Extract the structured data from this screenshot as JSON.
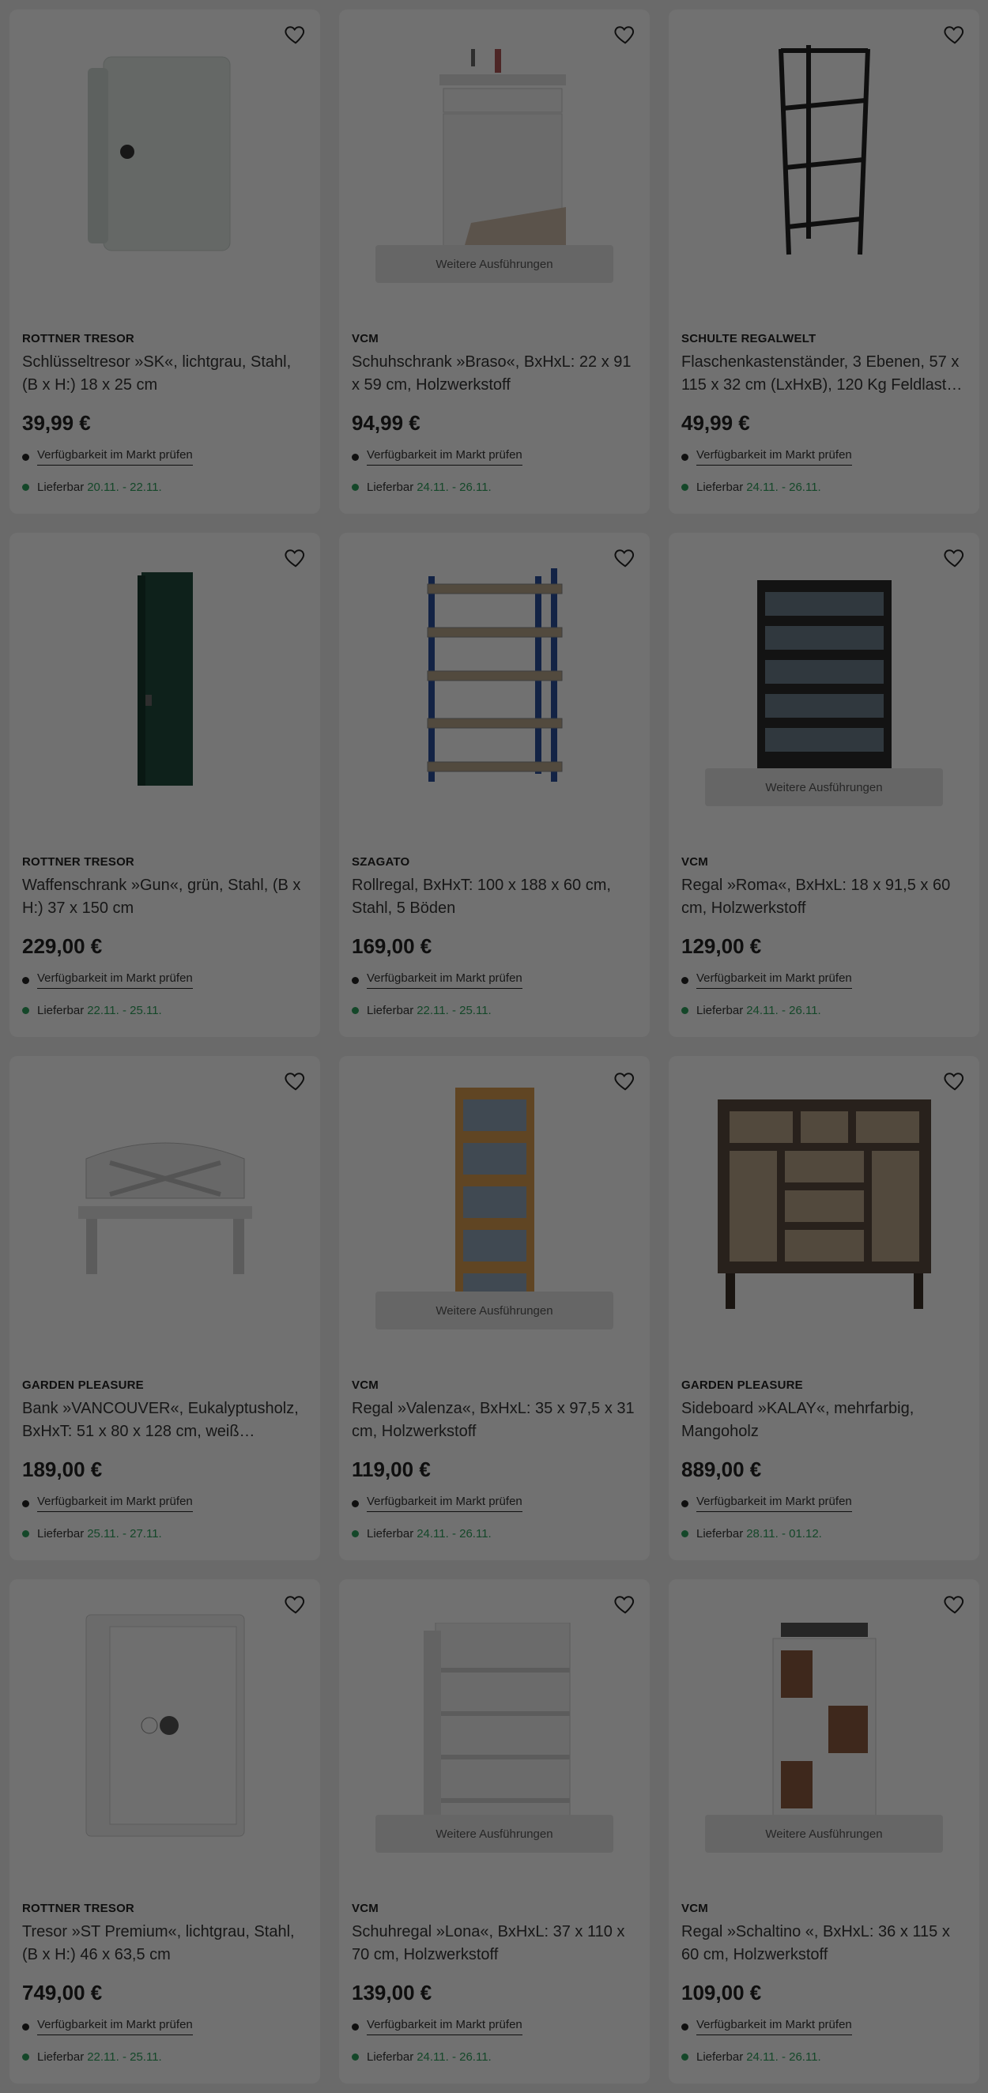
{
  "products": [
    {
      "brand": "ROTTNER TRESOR",
      "title": "Schlüsseltresor »SK«, lichtgrau, Stahl, (B x H:) 18 x 25 cm",
      "price": "39,99 €",
      "availability": "Verfügbarkeit im Markt prüfen",
      "delivery_label": "Lieferbar",
      "delivery_dates": "20.11. - 22.11.",
      "variants": "",
      "image": "key-safe"
    },
    {
      "brand": "VCM",
      "title": "Schuhschrank »Braso«, BxHxL: 22 x 91 x 59 cm, Holzwerkstoff",
      "price": "94,99 €",
      "availability": "Verfügbarkeit im Markt prüfen",
      "delivery_label": "Lieferbar",
      "delivery_dates": "24.11. - 26.11.",
      "variants": "Weitere Ausführungen",
      "image": "shoe-cabinet"
    },
    {
      "brand": "SCHULTE REGALWELT",
      "title": "Flaschenkastenständer, 3 Ebenen, 57 x 115 x 32 cm (LxHxB), 120 Kg Feldlast…",
      "price": "49,99 €",
      "availability": "Verfügbarkeit im Markt prüfen",
      "delivery_label": "Lieferbar",
      "delivery_dates": "24.11. - 26.11.",
      "variants": "",
      "image": "crate-rack"
    },
    {
      "brand": "ROTTNER TRESOR",
      "title": "Waffenschrank »Gun«, grün, Stahl, (B x H:) 37 x 150 cm",
      "price": "229,00 €",
      "availability": "Verfügbarkeit im Markt prüfen",
      "delivery_label": "Lieferbar",
      "delivery_dates": "22.11. - 25.11.",
      "variants": "",
      "image": "gun-cabinet"
    },
    {
      "brand": "SZAGATO",
      "title": "Rollregal, BxHxT: 100 x 188 x 60 cm, Stahl, 5 Böden",
      "price": "169,00 €",
      "availability": "Verfügbarkeit im Markt prüfen",
      "delivery_label": "Lieferbar",
      "delivery_dates": "22.11. - 25.11.",
      "variants": "",
      "image": "rolling-shelf"
    },
    {
      "brand": "VCM",
      "title": "Regal »Roma«, BxHxL: 18 x 91,5 x 60 cm, Holzwerkstoff",
      "price": "129,00 €",
      "availability": "Verfügbarkeit im Markt prüfen",
      "delivery_label": "Lieferbar",
      "delivery_dates": "24.11. - 26.11.",
      "variants": "Weitere Ausführungen",
      "image": "cd-shelf-dark"
    },
    {
      "brand": "GARDEN PLEASURE",
      "title": "Bank »VANCOUVER«, Eukalyptusholz, BxHxT: 51 x 80 x 128 cm, weiß…",
      "price": "189,00 €",
      "availability": "Verfügbarkeit im Markt prüfen",
      "delivery_label": "Lieferbar",
      "delivery_dates": "25.11. - 27.11.",
      "variants": "",
      "image": "bench"
    },
    {
      "brand": "VCM",
      "title": "Regal »Valenza«, BxHxL: 35 x 97,5 x 31 cm, Holzwerkstoff",
      "price": "119,00 €",
      "availability": "Verfügbarkeit im Markt prüfen",
      "delivery_label": "Lieferbar",
      "delivery_dates": "24.11. - 26.11.",
      "variants": "Weitere Ausführungen",
      "image": "cd-tower"
    },
    {
      "brand": "GARDEN PLEASURE",
      "title": "Sideboard »KALAY«, mehrfarbig, Mangoholz",
      "price": "889,00 €",
      "availability": "Verfügbarkeit im Markt prüfen",
      "delivery_label": "Lieferbar",
      "delivery_dates": "28.11. - 01.12.",
      "variants": "",
      "image": "sideboard"
    },
    {
      "brand": "ROTTNER TRESOR",
      "title": "Tresor »ST Premium«, lichtgrau, Stahl, (B x H:) 46 x 63,5 cm",
      "price": "749,00 €",
      "availability": "Verfügbarkeit im Markt prüfen",
      "delivery_label": "Lieferbar",
      "delivery_dates": "22.11. - 25.11.",
      "variants": "",
      "image": "safe"
    },
    {
      "brand": "VCM",
      "title": "Schuhregal »Lona«, BxHxL: 37 x 110 x 70 cm, Holzwerkstoff",
      "price": "139,00 €",
      "availability": "Verfügbarkeit im Markt prüfen",
      "delivery_label": "Lieferbar",
      "delivery_dates": "24.11. - 26.11.",
      "variants": "Weitere Ausführungen",
      "image": "shoe-shelf"
    },
    {
      "brand": "VCM",
      "title": "Regal »Schaltino «, BxHxL: 36 x 115 x 60 cm, Holzwerkstoff",
      "price": "109,00 €",
      "availability": "Verfügbarkeit im Markt prüfen",
      "delivery_label": "Lieferbar",
      "delivery_dates": "24.11. - 26.11.",
      "variants": "Weitere Ausführungen",
      "image": "record-shelf"
    }
  ],
  "colors": {
    "accent_green": "#2e9e5b",
    "overlay": "rgba(0,0,0,0.55)"
  }
}
